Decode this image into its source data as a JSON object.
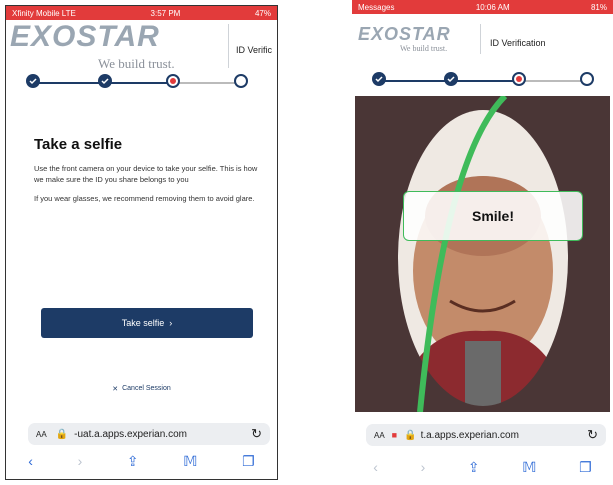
{
  "left": {
    "status": {
      "carrier": "Xfinity Mobile LTE",
      "time": "3:57 PM",
      "battery": "47%"
    },
    "logo": "EXOSTAR",
    "tagline": "We build trust.",
    "header_title": "ID Verific",
    "steps": [
      "done",
      "done",
      "active",
      "todo"
    ],
    "title": "Take a selfie",
    "body1": "Use the front camera on your device to take your selfie. This is how we make sure the ID you share belongs to you",
    "body2": "If you wear glasses, we recommend removing them to avoid glare.",
    "primary_button": "Take selfie",
    "cancel_link": "Cancel Session",
    "address": {
      "aa": "AA",
      "url": "-uat.a.apps.experian.com"
    },
    "toolbar": [
      "back-icon",
      "forward-icon",
      "share-icon",
      "bookmarks-icon",
      "tabs-icon"
    ]
  },
  "right": {
    "status": {
      "back_label": "Messages",
      "time": "10:06 AM",
      "battery": "81%"
    },
    "logo": "EXOSTAR",
    "tagline": "We build trust.",
    "header_title": "ID Verification",
    "steps": [
      "done",
      "done",
      "active",
      "todo"
    ],
    "smile_label": "Smile!",
    "address": {
      "aa": "AA",
      "url": "t.a.apps.experian.com"
    },
    "toolbar": [
      "back-icon",
      "forward-icon",
      "share-icon",
      "bookmarks-icon",
      "tabs-icon"
    ]
  },
  "colors": {
    "navy": "#1d3b66",
    "accent_red": "#e23b3b",
    "ring_green": "#3fbb5a"
  }
}
